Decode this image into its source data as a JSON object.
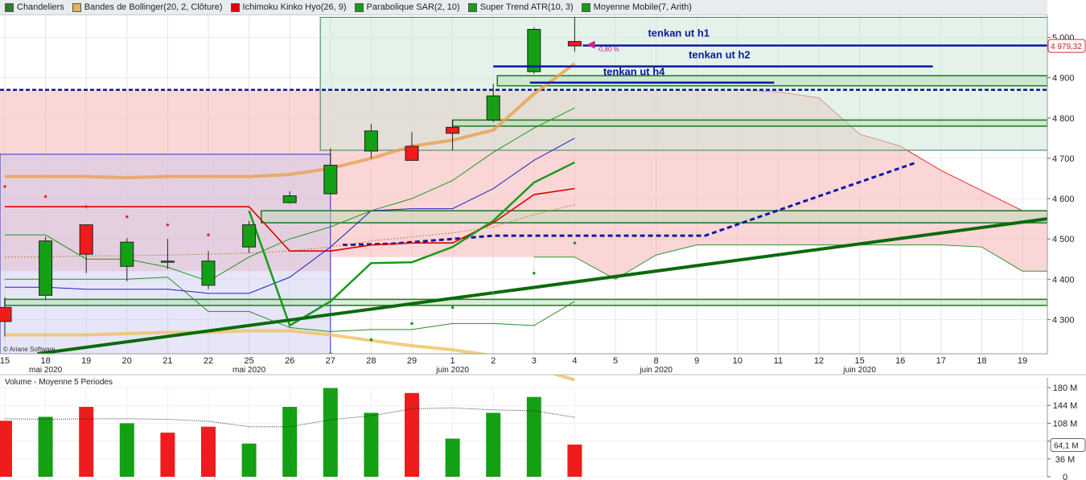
{
  "legend": [
    {
      "label": "Chandeliers",
      "color": "#2e7d32"
    },
    {
      "label": "Bandes de Bollinger(20, 2, Clôture)",
      "color": "#e8b060"
    },
    {
      "label": "Ichimoku Kinko Hyo(26, 9)",
      "color": "#e00000"
    },
    {
      "label": "Parabolique SAR(2, 10)",
      "color": "#1a9a1a"
    },
    {
      "label": "Super Trend ATR(10, 3)",
      "color": "#1a9a1a"
    },
    {
      "label": "Moyenne Mobile(7, Arith)",
      "color": "#1a9a1a"
    }
  ],
  "chart_data": [
    {
      "type": "candlestick",
      "x_ticks": [
        "15",
        "18",
        "19",
        "20",
        "21",
        "22",
        "25",
        "26",
        "27",
        "28",
        "29",
        "1",
        "2",
        "3",
        "4",
        "5",
        "8",
        "9",
        "10",
        "11",
        "12",
        "15",
        "16",
        "17",
        "18",
        "19"
      ],
      "month_labels": [
        "mai 2020",
        "mai 2020",
        "juin 2020",
        "juin 2020",
        "juin 2020"
      ],
      "y_ticks": [
        4300,
        4400,
        4500,
        4600,
        4700,
        4800,
        4900,
        5000
      ],
      "y_tick_labels": [
        "4 300",
        "4 400",
        "4 500",
        "4 600",
        "4 700",
        "4 800",
        "4 900",
        "5 000"
      ],
      "ylim": [
        4215,
        5055
      ],
      "candles": [
        {
          "x": "15",
          "open": 4330,
          "high": 4355,
          "low": 4258,
          "close": 4295
        },
        {
          "x": "18",
          "open": 4360,
          "high": 4505,
          "low": 4350,
          "close": 4495
        },
        {
          "x": "19",
          "open": 4535,
          "high": 4535,
          "low": 4415,
          "close": 4462
        },
        {
          "x": "20",
          "open": 4432,
          "high": 4502,
          "low": 4395,
          "close": 4492
        },
        {
          "x": "21",
          "open": 4442,
          "high": 4500,
          "low": 4425,
          "close": 4445
        },
        {
          "x": "22",
          "open": 4385,
          "high": 4470,
          "low": 4375,
          "close": 4445
        },
        {
          "x": "25",
          "open": 4480,
          "high": 4545,
          "low": 4465,
          "close": 4535
        },
        {
          "x": "26",
          "open": 4590,
          "high": 4618,
          "low": 4588,
          "close": 4607
        },
        {
          "x": "27",
          "open": 4612,
          "high": 4725,
          "low": 4610,
          "close": 4683
        },
        {
          "x": "28",
          "open": 4718,
          "high": 4785,
          "low": 4700,
          "close": 4768
        },
        {
          "x": "29",
          "open": 4730,
          "high": 4765,
          "low": 4695,
          "close": 4695
        },
        {
          "x": "1",
          "open": 4777,
          "high": 4795,
          "low": 4720,
          "close": 4762
        },
        {
          "x": "2",
          "open": 4795,
          "high": 4885,
          "low": 4790,
          "close": 4855
        },
        {
          "x": "3",
          "open": 4915,
          "high": 5025,
          "low": 4910,
          "close": 5020
        },
        {
          "x": "4",
          "open": 4990,
          "high": 5050,
          "low": 4965,
          "close": 4979
        }
      ],
      "last_price_label": "4 979,32",
      "change_label": "-0,80 %",
      "annotations": [
        "tenkan ut h1",
        "tenkan ut h2",
        "tenkan ut h4"
      ],
      "copyright": "© Ariane Software"
    },
    {
      "type": "bar",
      "title": "Volume  - Moyenne 5 Periodes",
      "y_ticks": [
        0,
        36,
        72,
        108,
        144,
        180
      ],
      "y_tick_labels": [
        "0",
        "36 M",
        "72 M",
        "108 M",
        "144 M",
        "180 M"
      ],
      "ylim": [
        0,
        180
      ],
      "last_value_label": "64,1 M",
      "categories": [
        "15",
        "18",
        "19",
        "20",
        "21",
        "22",
        "25",
        "26",
        "27",
        "28",
        "29",
        "1",
        "2",
        "3",
        "4"
      ],
      "values": [
        113,
        121,
        141,
        108,
        89,
        101,
        67,
        141,
        179,
        129,
        169,
        77,
        129,
        161,
        65
      ],
      "direction": [
        "down",
        "up",
        "down",
        "up",
        "down",
        "down",
        "up",
        "up",
        "up",
        "up",
        "down",
        "up",
        "up",
        "up",
        "down"
      ],
      "moving_average": [
        null,
        null,
        null,
        null,
        116,
        112,
        101,
        101,
        115,
        123,
        137,
        139,
        135,
        133,
        120
      ]
    }
  ],
  "colors": {
    "up": "#14a014",
    "down": "#ee1c1c",
    "bollinger": "#e8a050",
    "trend_line": "#0a6a0a",
    "annotation": "#0b1aa0"
  }
}
